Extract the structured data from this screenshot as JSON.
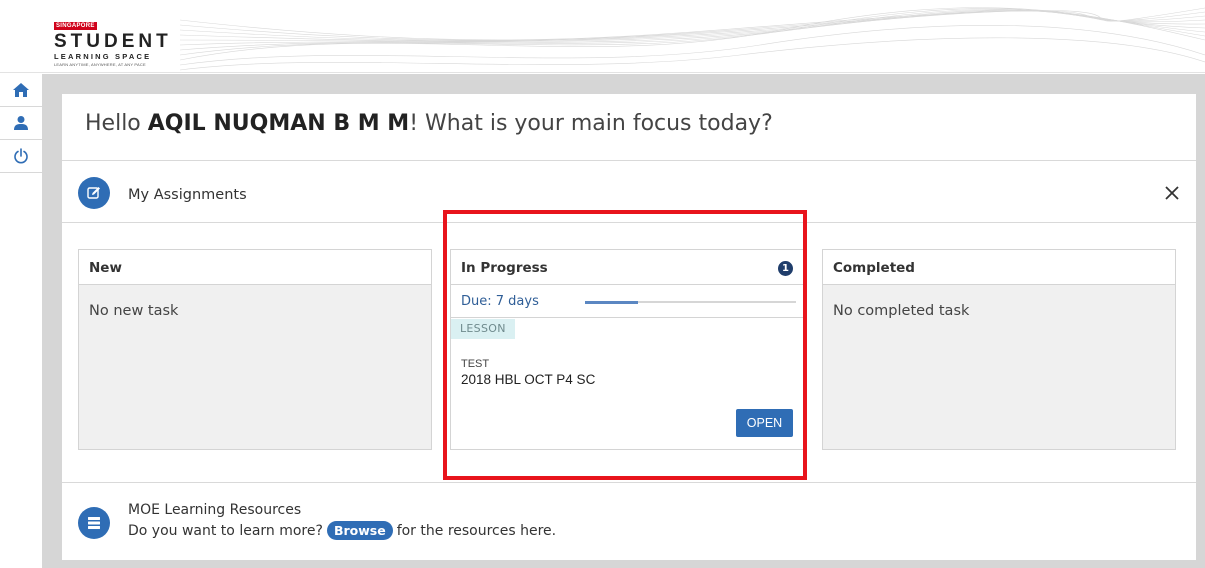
{
  "logo": {
    "tag": "SINGAPORE",
    "title": "STUDENT",
    "subtitle": "LEARNING SPACE",
    "tagline": "LEARN ANYTIME, ANYWHERE, AT ANY PACE"
  },
  "nav": {
    "items": [
      {
        "icon": "home-icon"
      },
      {
        "icon": "user-icon"
      },
      {
        "icon": "power-icon"
      }
    ]
  },
  "greeting": {
    "hello": "Hello",
    "name": "AQIL NUQMAN B M M",
    "exclaim": "!",
    "question": "What is your main focus today?"
  },
  "assignments": {
    "title": "My Assignments",
    "icon": "edit-icon",
    "close_icon": "close-icon",
    "columns": {
      "new": {
        "header": "New",
        "empty_text": "No new task"
      },
      "in_progress": {
        "header": "In Progress",
        "count": "1",
        "task": {
          "due": "Due: 7 days",
          "progress": 0.25,
          "tag": "LESSON",
          "type": "TEST",
          "name": "2018 HBL OCT P4 SC",
          "open_label": "OPEN"
        }
      },
      "completed": {
        "header": "Completed",
        "empty_text": "No completed task"
      }
    }
  },
  "resources": {
    "title": "MOE Learning Resources",
    "text_before": "Do you want to learn more?",
    "browse_label": "Browse",
    "text_after": "for the resources here.",
    "icon": "resources-icon"
  },
  "colors": {
    "accent": "#2f6db5",
    "highlight": "#e8141c",
    "badge": "#1f3d6b",
    "tag_bg": "#daf0f2"
  }
}
